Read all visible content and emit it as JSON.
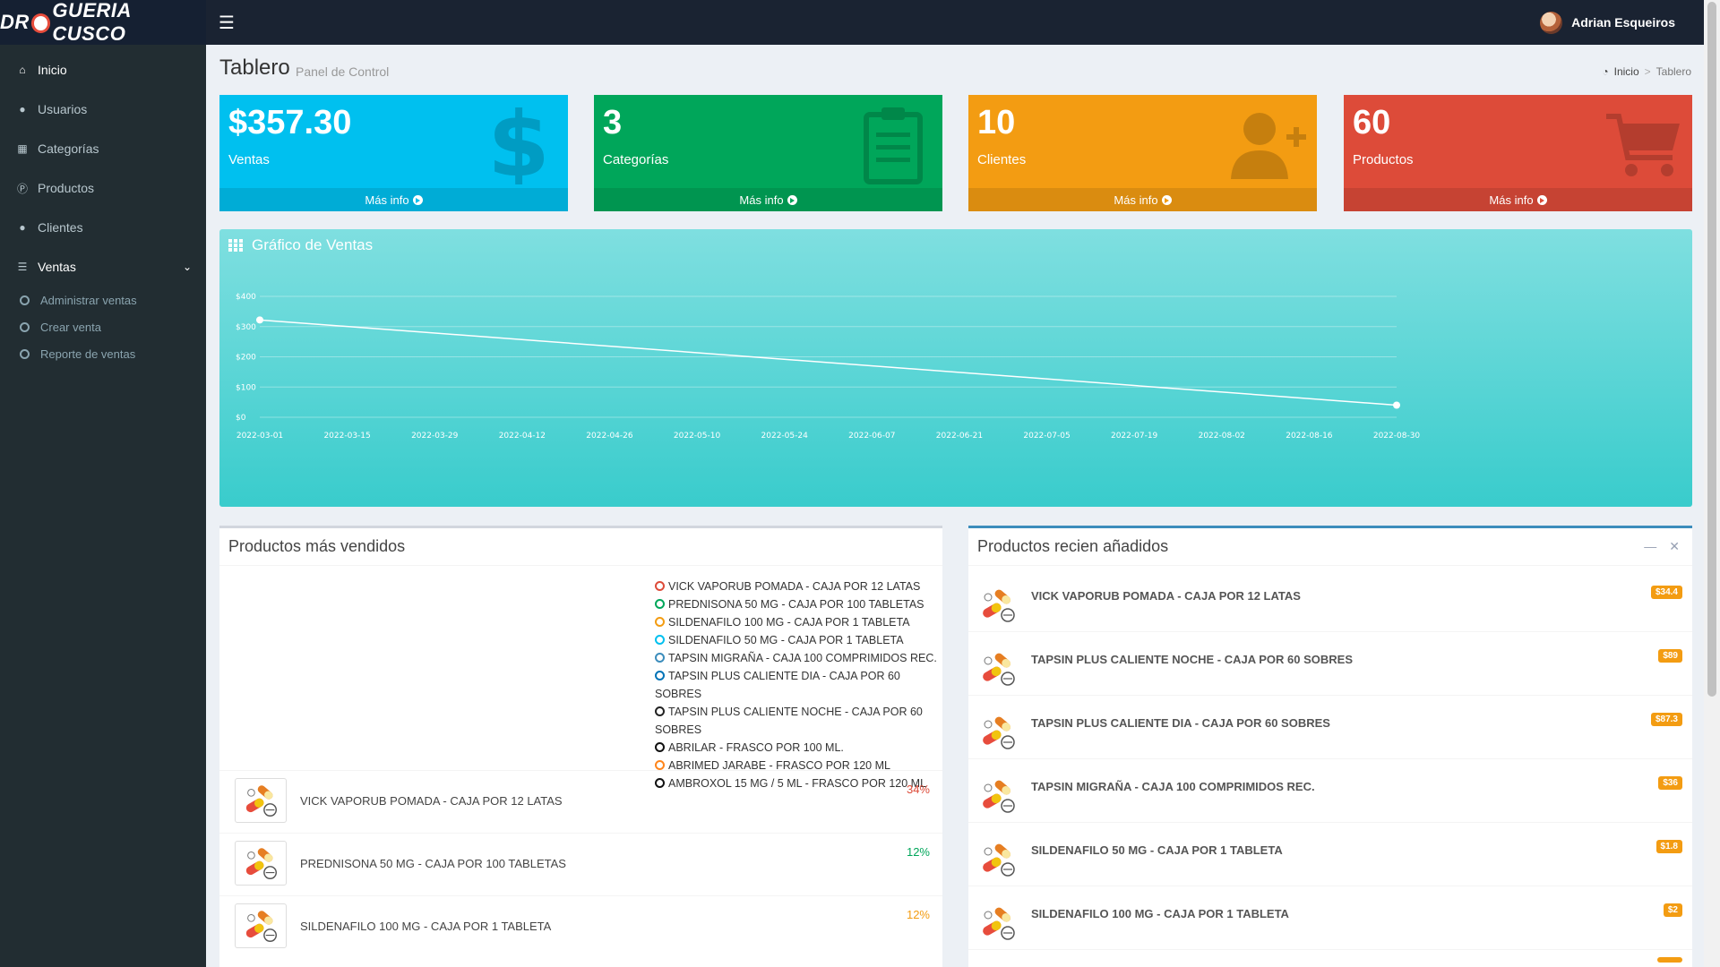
{
  "app": {
    "logo_left": "DR",
    "logo_right": "GUERIA CUSCO",
    "user_name": "Adrian Esqueiros"
  },
  "sidebar": {
    "items": [
      {
        "label": "Inicio",
        "icon": "home-icon"
      },
      {
        "label": "Usuarios",
        "icon": "user-icon"
      },
      {
        "label": "Categorías",
        "icon": "grid-icon"
      },
      {
        "label": "Productos",
        "icon": "product-p-icon"
      },
      {
        "label": "Clientes",
        "icon": "users-icon"
      },
      {
        "label": "Ventas",
        "icon": "list-icon"
      }
    ],
    "sub_items": [
      "Administrar ventas",
      "Crear venta",
      "Reporte de ventas"
    ]
  },
  "page": {
    "title": "Tablero",
    "subtitle": "Panel de Control",
    "breadcrumb_home": "Inicio",
    "breadcrumb_current": "Tablero"
  },
  "boxes": [
    {
      "value": "$357.30",
      "label": "Ventas",
      "footer": "Más info",
      "color": "#00c0ef",
      "icon": "dollar-icon"
    },
    {
      "value": "3",
      "label": "Categorías",
      "footer": "Más info",
      "color": "#00a65a",
      "icon": "clipboard-icon"
    },
    {
      "value": "10",
      "label": "Clientes",
      "footer": "Más info",
      "color": "#f39c12",
      "icon": "user-plus-icon"
    },
    {
      "value": "60",
      "label": "Productos",
      "footer": "Más info",
      "color": "#dd4b39",
      "icon": "cart-icon"
    }
  ],
  "chart_title": "Gráfico de Ventas",
  "chart_data": {
    "type": "line",
    "title": "",
    "y_ticks": [
      "$0",
      "$100",
      "$200",
      "$300",
      "$400"
    ],
    "ylim": [
      0,
      400
    ],
    "x_ticks": [
      "2022-03-01",
      "2022-03-15",
      "2022-03-29",
      "2022-04-12",
      "2022-04-26",
      "2022-05-10",
      "2022-05-24",
      "2022-06-07",
      "2022-06-21",
      "2022-07-05",
      "2022-07-19",
      "2022-08-02",
      "2022-08-16",
      "2022-08-30"
    ],
    "points": [
      {
        "x": "2022-03-01",
        "y": 322
      },
      {
        "x": "2022-08-30",
        "y": 40
      }
    ],
    "grid": true,
    "line_color": "#ffffff"
  },
  "best_sellers": {
    "title": "Productos más vendidos",
    "legend": [
      {
        "label": "VICK VAPORUB POMADA - CAJA POR 12 LATAS",
        "color": "#dd4b39"
      },
      {
        "label": "PREDNISONA 50 MG - CAJA POR 100 TABLETAS",
        "color": "#00a65a"
      },
      {
        "label": "SILDENAFILO 100 MG - CAJA POR 1 TABLETA",
        "color": "#f39c12"
      },
      {
        "label": "SILDENAFILO 50 MG - CAJA POR 1 TABLETA",
        "color": "#00c0ef"
      },
      {
        "label": "TAPSIN MIGRAÑA - CAJA 100 COMPRIMIDOS REC.",
        "color": "#3c8dbc"
      },
      {
        "label": "TAPSIN PLUS CALIENTE DIA - CAJA POR 60 SOBRES",
        "color": "#0073b7"
      },
      {
        "label": "TAPSIN PLUS CALIENTE NOCHE - CAJA POR 60 SOBRES",
        "color": "#222222"
      },
      {
        "label": "ABRILAR - FRASCO POR 100 ML.",
        "color": "#111111"
      },
      {
        "label": "ABRIMED JARABE - FRASCO POR 120 ML",
        "color": "#ff851b"
      },
      {
        "label": "AMBROXOL 15 MG / 5 ML - FRASCO POR 120 ML",
        "color": "#111111"
      }
    ],
    "rows": [
      {
        "name": "VICK VAPORUB POMADA - CAJA POR 12 LATAS",
        "percent": "34%",
        "color": "#dd4b39"
      },
      {
        "name": "PREDNISONA 50 MG - CAJA POR 100 TABLETAS",
        "percent": "12%",
        "color": "#00a65a"
      },
      {
        "name": "SILDENAFILO 100 MG - CAJA POR 1 TABLETA",
        "percent": "12%",
        "color": "#f39c12"
      }
    ]
  },
  "recent": {
    "title": "Productos recien añadidos",
    "rows": [
      {
        "name": "VICK VAPORUB POMADA - CAJA POR 12 LATAS",
        "price": "$34.4"
      },
      {
        "name": "TAPSIN PLUS CALIENTE NOCHE - CAJA POR 60 SOBRES",
        "price": "$89"
      },
      {
        "name": "TAPSIN PLUS CALIENTE DIA - CAJA POR 60 SOBRES",
        "price": "$87.3"
      },
      {
        "name": "TAPSIN MIGRAÑA - CAJA 100 COMPRIMIDOS REC.",
        "price": "$36"
      },
      {
        "name": "SILDENAFILO 50 MG - CAJA POR 1 TABLETA",
        "price": "$1.8"
      },
      {
        "name": "SILDENAFILO 100 MG - CAJA POR 1 TABLETA",
        "price": "$2"
      },
      {
        "name": "",
        "price": ""
      }
    ]
  }
}
